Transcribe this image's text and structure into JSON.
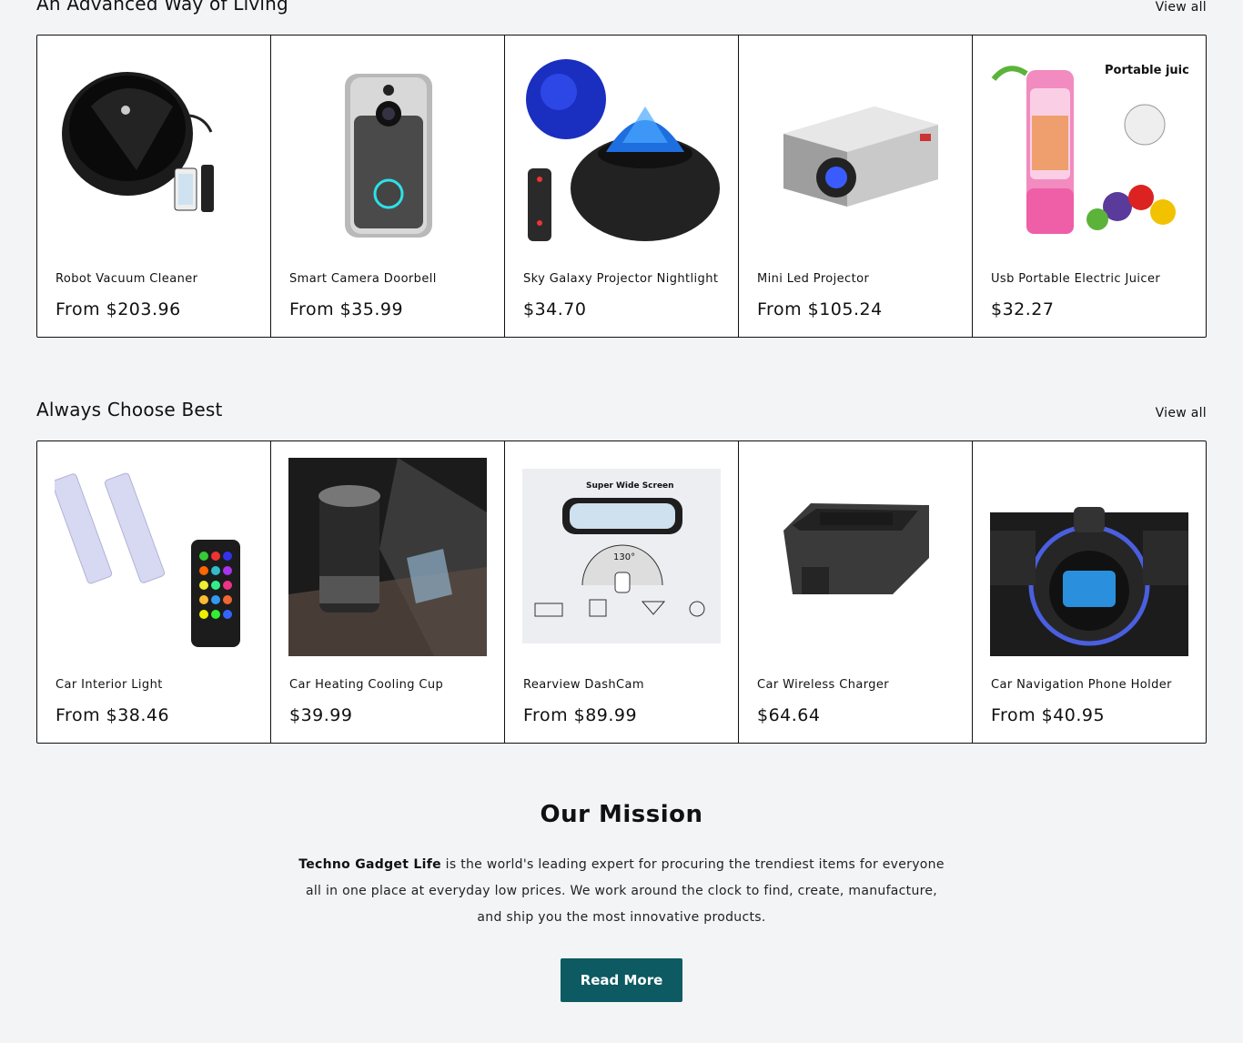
{
  "section1": {
    "title": "An Advanced Way of Living",
    "view_all": "View all",
    "products": [
      {
        "name": "Robot Vacuum Cleaner",
        "price": "From $203.96",
        "icon": "robot-vacuum-image"
      },
      {
        "name": "Smart Camera Doorbell",
        "price": "From $35.99",
        "icon": "doorbell-image"
      },
      {
        "name": "Sky Galaxy Projector Nightlight",
        "price": "$34.70",
        "icon": "galaxy-projector-image"
      },
      {
        "name": "Mini Led Projector",
        "price": "From $105.24",
        "icon": "projector-image"
      },
      {
        "name": "Usb Portable Electric Juicer",
        "price": "$32.27",
        "icon": "juicer-image",
        "badge": "Portable juicer"
      }
    ]
  },
  "section2": {
    "title": "Always Choose Best",
    "view_all": "View all",
    "products": [
      {
        "name": "Car Interior Light",
        "price": "From $38.46",
        "icon": "interior-light-image"
      },
      {
        "name": "Car Heating Cooling Cup",
        "price": "$39.99",
        "icon": "cup-image"
      },
      {
        "name": "Rearview DashCam",
        "price": "From $89.99",
        "icon": "dashcam-image",
        "badge": "Super Wide Screen",
        "angle": "130°"
      },
      {
        "name": "Car Wireless Charger",
        "price": "$64.64",
        "icon": "wireless-charger-image"
      },
      {
        "name": "Car Navigation Phone Holder",
        "price": "From $40.95",
        "icon": "phone-holder-image"
      }
    ]
  },
  "mission": {
    "title": "Our Mission",
    "brand": "Techno Gadget Life",
    "text": " is the world's leading expert for procuring the trendiest items for everyone all in one place at everyday low prices. We work around the clock to find, create, manufacture, and ship you the most innovative products.",
    "button": "Read More",
    "button_color": "#0d5a62"
  }
}
